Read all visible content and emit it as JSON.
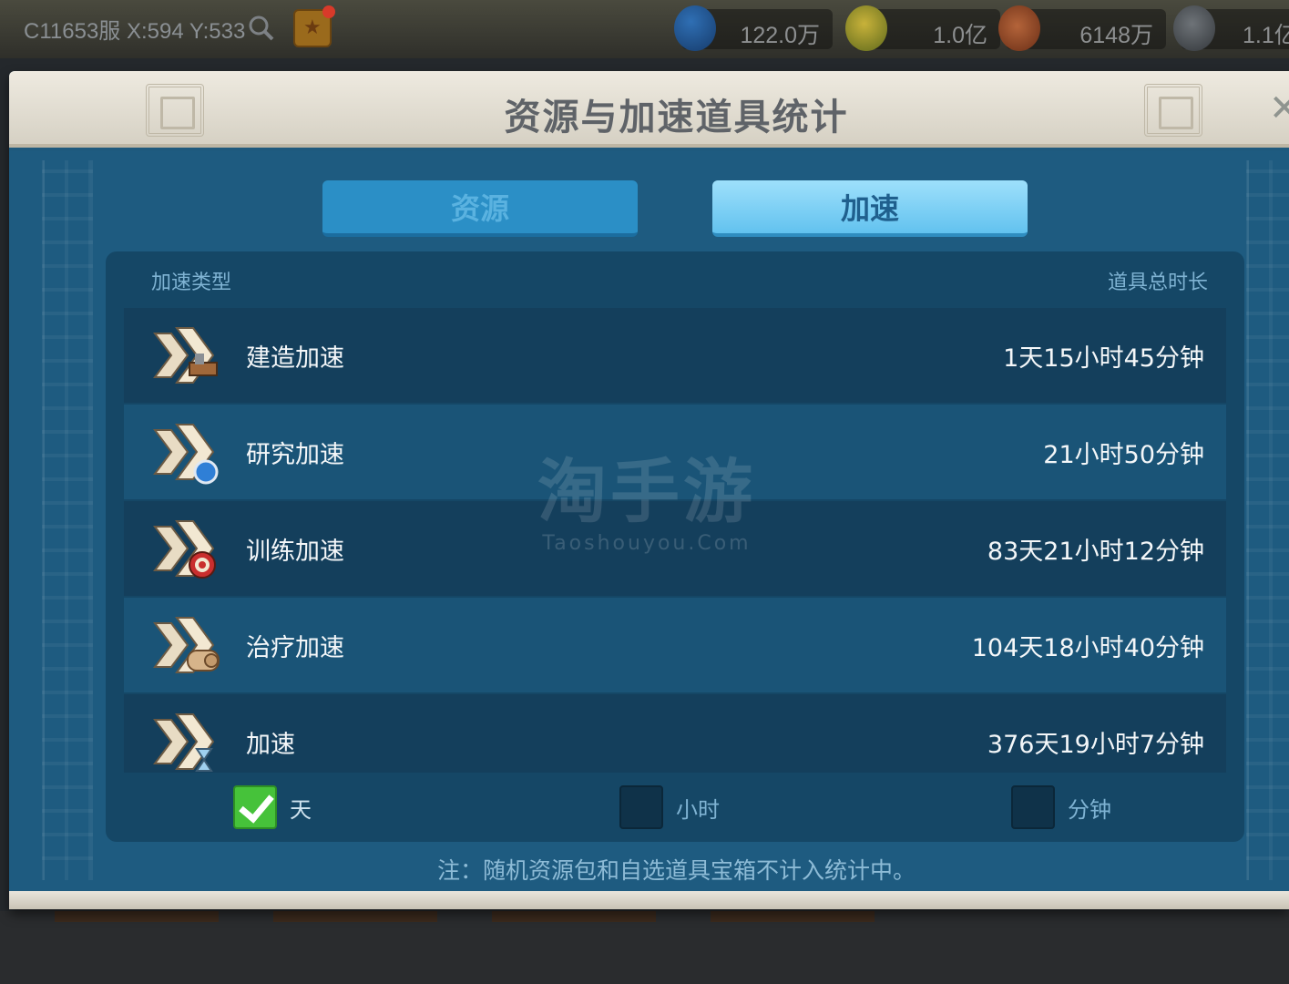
{
  "hud": {
    "coords": "C11653服 X:594 Y:533",
    "resources": [
      {
        "icon": "gem-icon",
        "value": "122.0万"
      },
      {
        "icon": "food-icon",
        "value": "1.0亿"
      },
      {
        "icon": "wood-icon",
        "value": "6148万"
      },
      {
        "icon": "stone-icon",
        "value": "1.1亿"
      }
    ]
  },
  "dialog": {
    "title": "资源与加速道具统计",
    "tabs": {
      "resources": "资源",
      "speedup": "加速"
    },
    "selected_tab": "speedup",
    "columns": {
      "type": "加速类型",
      "total": "道具总时长"
    },
    "rows": [
      {
        "label": "建造加速",
        "value": "1天15小时45分钟",
        "icon": "build-speedup-icon"
      },
      {
        "label": "研究加速",
        "value": "21小时50分钟",
        "icon": "research-speedup-icon"
      },
      {
        "label": "训练加速",
        "value": "83天21小时12分钟",
        "icon": "training-speedup-icon"
      },
      {
        "label": "治疗加速",
        "value": "104天18小时40分钟",
        "icon": "healing-speedup-icon"
      },
      {
        "label": "加速",
        "value": "376天19小时7分钟",
        "icon": "universal-speedup-icon"
      }
    ],
    "units": [
      {
        "label": "天",
        "checked": true
      },
      {
        "label": "小时",
        "checked": false
      },
      {
        "label": "分钟",
        "checked": false
      }
    ],
    "note": "注：随机资源包和自选道具宝箱不计入统计中。"
  },
  "watermark": {
    "main": "淘手游",
    "sub": "Taoshouyou.Com"
  },
  "colors": {
    "panel_bg": "#1e5b80",
    "selected_tab": "#7cd0f6",
    "check_green": "#46c23a"
  }
}
